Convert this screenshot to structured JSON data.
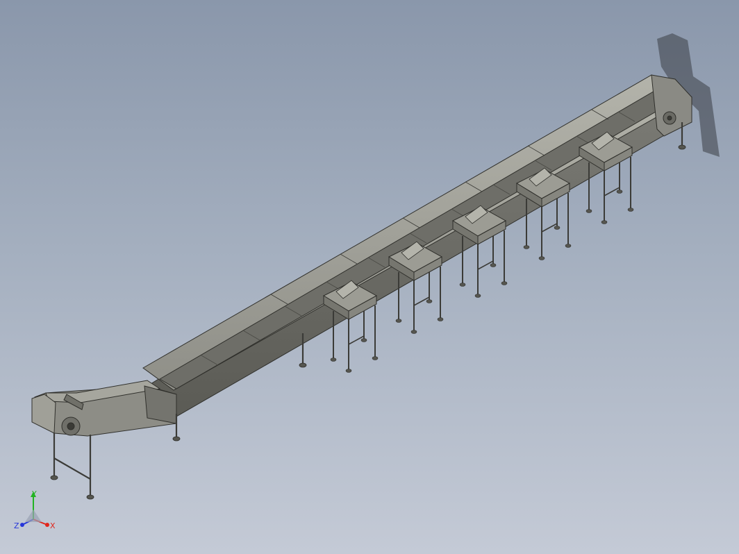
{
  "viewport": {
    "background_top": "#8a97ab",
    "background_bottom": "#c4cad6",
    "model": "conveyor-assembly"
  },
  "triad": {
    "x_label": "X",
    "y_label": "Y",
    "z_label": "Z",
    "x_color": "#e0261c",
    "y_color": "#22b322",
    "z_color": "#2636d9"
  },
  "colors": {
    "steel_light": "#a9a9a0",
    "steel_mid": "#8c8c85",
    "steel_dark": "#55554f",
    "edge": "#2f2f2b"
  }
}
